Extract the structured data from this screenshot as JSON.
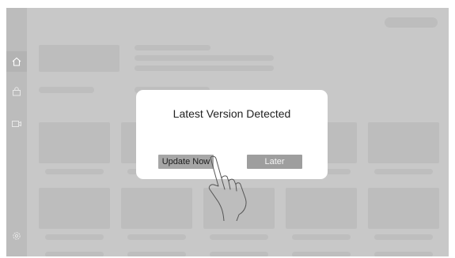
{
  "dialog": {
    "title": "Latest Version Detected",
    "primary_button": "Update Now",
    "secondary_button": "Later"
  },
  "sidebar": {
    "items": [
      {
        "name": "home",
        "icon": "home-icon",
        "active": true
      },
      {
        "name": "store",
        "icon": "bag-icon",
        "active": false
      },
      {
        "name": "media",
        "icon": "video-icon",
        "active": false
      }
    ],
    "footer_icon": "gear-icon"
  },
  "colors": {
    "background": "#c8c8c8",
    "sidebar": "#bcbcbc",
    "dialog": "#ffffff",
    "primary_button": "#a6a6a6",
    "secondary_button": "#9e9e9e"
  }
}
